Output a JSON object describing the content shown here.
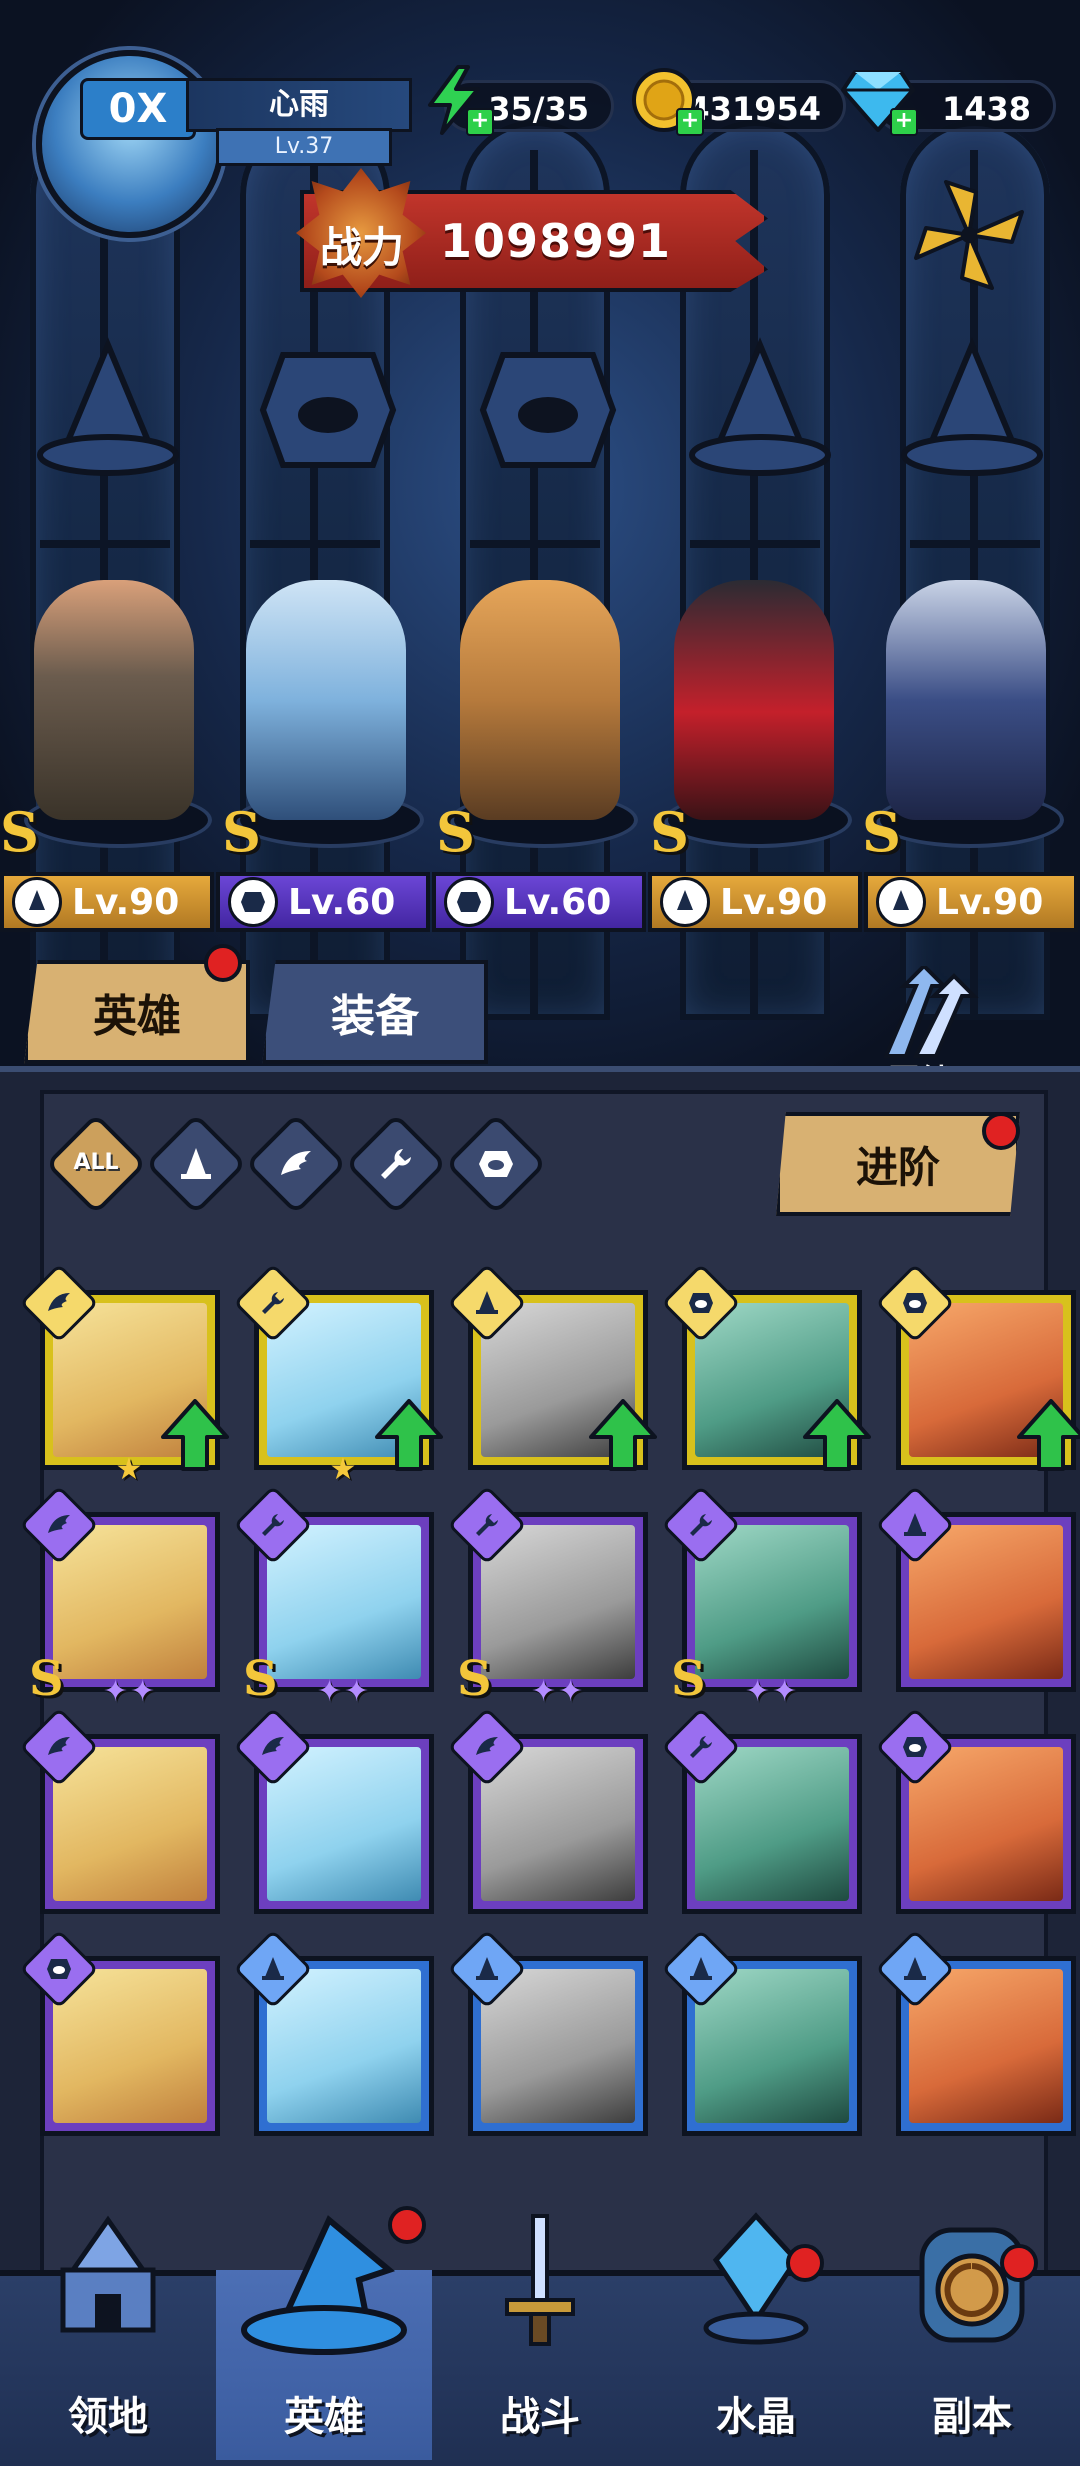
{
  "player": {
    "name": "心雨",
    "level": "Lv.37",
    "avatar_badge": "0X"
  },
  "resources": {
    "stamina": "35/35",
    "gold": "431954",
    "gems": "1438"
  },
  "power": {
    "label": "战力",
    "value": "1098991"
  },
  "lineup": [
    {
      "class_icon": "wizard-hat-icon",
      "rank": "S",
      "level": "Lv.90",
      "plate_color": "#d69a32"
    },
    {
      "class_icon": "demon-face-icon",
      "rank": "S",
      "level": "Lv.60",
      "plate_color": "#5a36c4"
    },
    {
      "class_icon": "demon-face-icon",
      "rank": "S",
      "level": "Lv.60",
      "plate_color": "#5a36c4"
    },
    {
      "class_icon": "wizard-hat-icon",
      "rank": "S",
      "level": "Lv.90",
      "plate_color": "#d69a32"
    },
    {
      "class_icon": "wizard-hat-icon",
      "rank": "S",
      "level": "Lv.90",
      "plate_color": "#d69a32"
    }
  ],
  "tabs": {
    "heroes": "英雄",
    "equipment": "装备"
  },
  "bond_label": "羁绊",
  "filters": {
    "all_label": "ALL",
    "icons": [
      "hat-icon",
      "wing-icon",
      "wrench-icon",
      "demon-icon"
    ]
  },
  "advance_button": "进阶",
  "hero_cards": [
    {
      "rarity": "gold",
      "class": "wing",
      "upgrade": true,
      "stars": "★",
      "rank": ""
    },
    {
      "rarity": "gold",
      "class": "wrench",
      "upgrade": true,
      "stars": "★",
      "rank": ""
    },
    {
      "rarity": "gold",
      "class": "hat",
      "upgrade": true,
      "stars": "",
      "rank": ""
    },
    {
      "rarity": "gold",
      "class": "demon",
      "upgrade": true,
      "stars": "",
      "rank": ""
    },
    {
      "rarity": "gold",
      "class": "demon",
      "upgrade": true,
      "stars": "",
      "rank": ""
    },
    {
      "rarity": "purple",
      "class": "wing",
      "upgrade": false,
      "stars": "✦✦",
      "rank": "S"
    },
    {
      "rarity": "purple",
      "class": "wrench",
      "upgrade": false,
      "stars": "✦✦",
      "rank": "S"
    },
    {
      "rarity": "purple",
      "class": "wrench",
      "upgrade": false,
      "stars": "✦✦",
      "rank": "S"
    },
    {
      "rarity": "purple",
      "class": "wrench",
      "upgrade": false,
      "stars": "✦✦",
      "rank": "S"
    },
    {
      "rarity": "purple",
      "class": "hat",
      "upgrade": false,
      "stars": "",
      "rank": ""
    },
    {
      "rarity": "purple",
      "class": "wing",
      "upgrade": false,
      "stars": "",
      "rank": ""
    },
    {
      "rarity": "purple",
      "class": "wing",
      "upgrade": false,
      "stars": "",
      "rank": ""
    },
    {
      "rarity": "purple",
      "class": "wing",
      "upgrade": false,
      "stars": "",
      "rank": ""
    },
    {
      "rarity": "purple",
      "class": "wrench",
      "upgrade": false,
      "stars": "",
      "rank": ""
    },
    {
      "rarity": "purple",
      "class": "demon",
      "upgrade": false,
      "stars": "",
      "rank": ""
    },
    {
      "rarity": "purple",
      "class": "demon",
      "upgrade": false,
      "stars": "",
      "rank": ""
    },
    {
      "rarity": "blue",
      "class": "hat",
      "upgrade": false,
      "stars": "",
      "rank": ""
    },
    {
      "rarity": "blue",
      "class": "hat",
      "upgrade": false,
      "stars": "",
      "rank": ""
    },
    {
      "rarity": "blue",
      "class": "hat",
      "upgrade": false,
      "stars": "",
      "rank": ""
    },
    {
      "rarity": "blue",
      "class": "hat",
      "upgrade": false,
      "stars": "",
      "rank": ""
    }
  ],
  "bottom_nav": [
    {
      "label": "领地",
      "icon": "castle-icon",
      "active": false,
      "badge": false
    },
    {
      "label": "英雄",
      "icon": "wizard-hat-icon",
      "active": true,
      "badge": true
    },
    {
      "label": "战斗",
      "icon": "sword-icon",
      "active": false,
      "badge": false
    },
    {
      "label": "水晶",
      "icon": "crystal-icon",
      "active": false,
      "badge": true
    },
    {
      "label": "副本",
      "icon": "portal-icon",
      "active": false,
      "badge": true
    }
  ],
  "colors": {
    "gold_card": "#d8c11c",
    "purple_card": "#6c3fbf",
    "blue_card": "#2f6fd1",
    "accent_tab": "#d8b172",
    "badge_red": "#e02222"
  }
}
